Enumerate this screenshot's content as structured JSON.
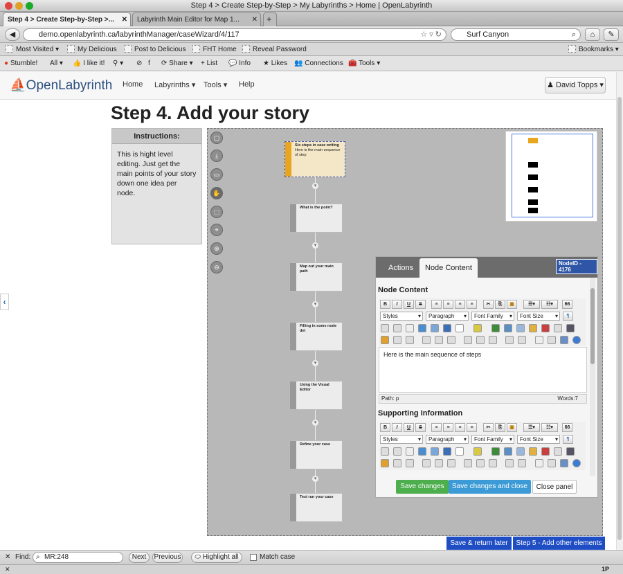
{
  "window": {
    "title": "Step 4 > Create Step-by-Step > My Labyrinths > Home | OpenLabyrinth"
  },
  "tabs": [
    {
      "label": "Step 4 > Create Step-by-Step >..."
    },
    {
      "label": "Labyrinth Main Editor for Map 1..."
    }
  ],
  "new_tab": "+",
  "nav": {
    "url": "demo.openlabyrinth.ca/labyrinthManager/caseWizard/4/117",
    "search_engine_text": "Surf Canyon"
  },
  "bookmarks": [
    "Most Visited",
    "My Delicious",
    "Post to Delicious",
    "FHT Home",
    "Reveal Password"
  ],
  "bookmarks_menu": "Bookmarks",
  "stumble": {
    "items": [
      "Stumble!",
      "All",
      "I like it!",
      "Share",
      "List",
      "Info",
      "Likes",
      "Connections",
      "Tools"
    ]
  },
  "site": {
    "logo_text": "OpenLabyrinth",
    "menu": [
      "Home",
      "Labyrinths",
      "Tools",
      "Help"
    ],
    "user": "David Topps"
  },
  "page": {
    "title": "Step 4. Add your story",
    "instructions_title": "Instructions:",
    "instructions_text": "This is hight level editing. Just get the main points of your story down one idea per node."
  },
  "nodes": [
    {
      "title": "Six steps in case writing",
      "body": "Here is the main sequence of step"
    },
    {
      "title": "What is the point?"
    },
    {
      "title": "Map out your main path"
    },
    {
      "title": "Filling in some node det"
    },
    {
      "title": "Using the Visual Editor"
    },
    {
      "title": "Refine your case"
    },
    {
      "title": "Test run your case"
    }
  ],
  "panel": {
    "tab_actions": "Actions",
    "tab_node_content": "Node Content",
    "node_id": "NodeID - 4176",
    "node_content_label": "Node Content",
    "node_content_text": "Here is the main sequence of steps",
    "path": "Path: p",
    "words": "Words:7",
    "supporting_label": "Supporting Information",
    "dropdowns": [
      "Styles",
      "Paragraph",
      "Font Family",
      "Font Size"
    ],
    "toolbar_row1": [
      "B",
      "I",
      "U",
      "S"
    ],
    "quote_btn": "66",
    "save": "Save changes",
    "save_close": "Save changes and close",
    "close": "Close panel"
  },
  "footer_buttons": {
    "save_return": "Save & return later",
    "next_step": "Step 5 - Add other elements"
  },
  "findbar": {
    "label": "Find:",
    "value": "MR:248",
    "next": "Next",
    "previous": "Previous",
    "highlight": "Highlight all",
    "match_case": "Match case"
  },
  "status": {
    "right": "1P"
  },
  "colors": {
    "accent_blue": "#1f4dc4",
    "save_green": "#4cae4c",
    "root_node": "#e8a520"
  }
}
